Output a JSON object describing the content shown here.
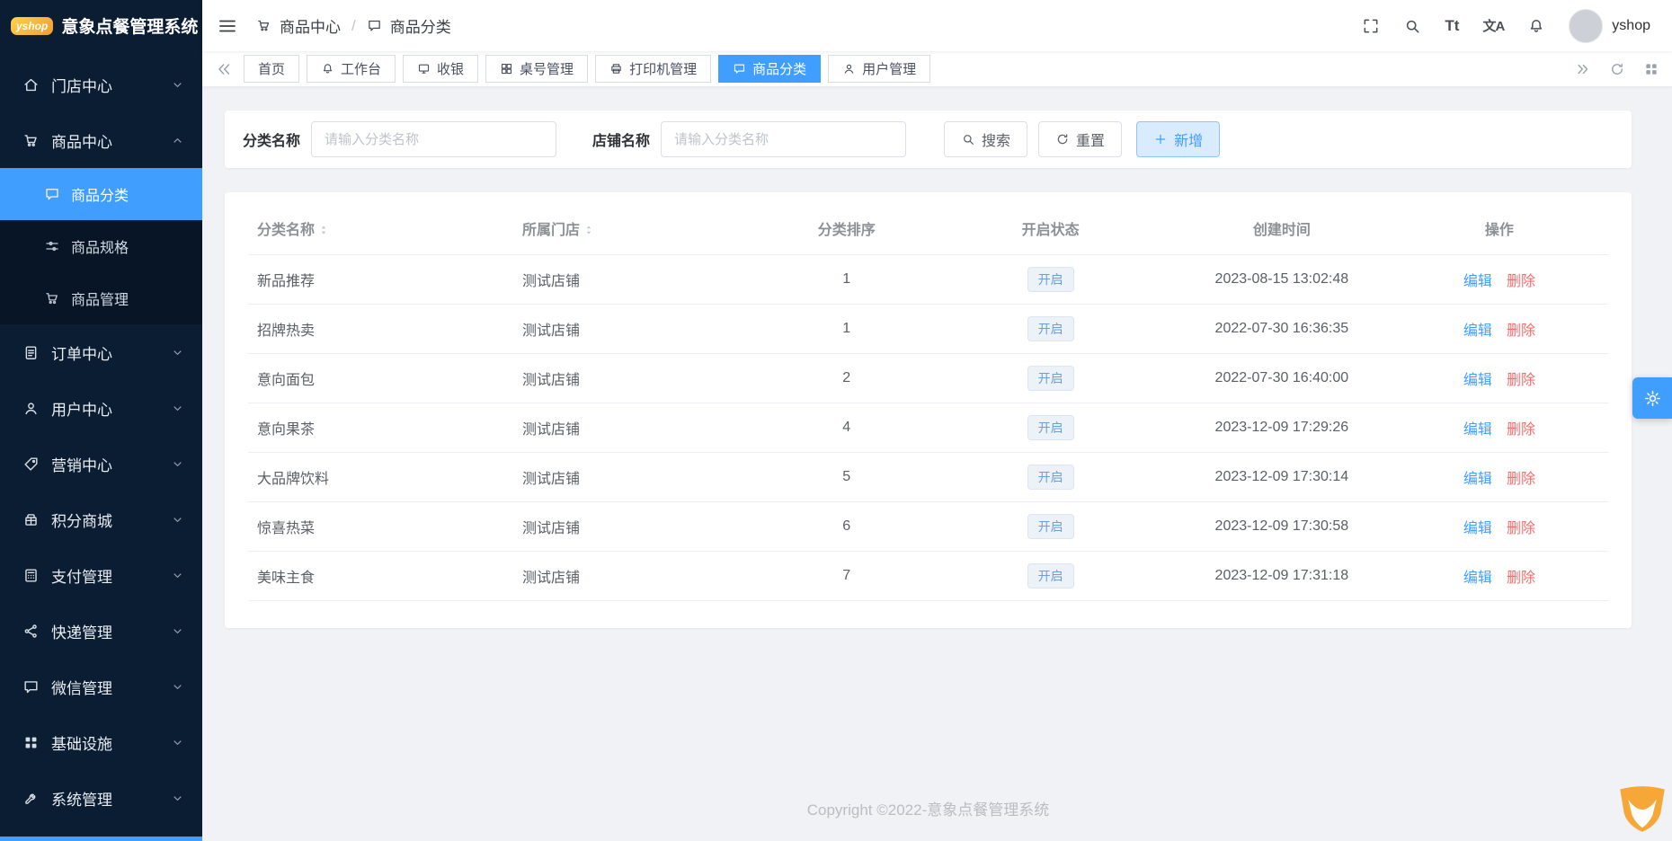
{
  "app": {
    "title": "意象点餐管理系统",
    "logo_text": "yshop",
    "footer": "Copyright ©2022-意象点餐管理系统"
  },
  "header": {
    "breadcrumb": {
      "parent": "商品中心",
      "current": "商品分类"
    },
    "username": "yshop",
    "font_icon": "Tt",
    "translate_icon": "文A"
  },
  "sidebar": {
    "items": [
      {
        "label": "门店中心"
      },
      {
        "label": "商品中心"
      },
      {
        "label": "订单中心"
      },
      {
        "label": "用户中心"
      },
      {
        "label": "营销中心"
      },
      {
        "label": "积分商城"
      },
      {
        "label": "支付管理"
      },
      {
        "label": "快递管理"
      },
      {
        "label": "微信管理"
      },
      {
        "label": "基础设施"
      },
      {
        "label": "系统管理"
      }
    ],
    "submenu": [
      {
        "label": "商品分类"
      },
      {
        "label": "商品规格"
      },
      {
        "label": "商品管理"
      }
    ]
  },
  "tabs": [
    {
      "label": "首页"
    },
    {
      "label": "工作台"
    },
    {
      "label": "收银"
    },
    {
      "label": "桌号管理"
    },
    {
      "label": "打印机管理"
    },
    {
      "label": "商品分类"
    },
    {
      "label": "用户管理"
    }
  ],
  "filters": {
    "category_label": "分类名称",
    "category_placeholder": "请输入分类名称",
    "shop_label": "店铺名称",
    "shop_placeholder": "请输入分类名称",
    "search": "搜索",
    "reset": "重置",
    "add": "新增"
  },
  "table": {
    "columns": [
      "分类名称",
      "所属门店",
      "分类排序",
      "开启状态",
      "创建时间",
      "操作"
    ],
    "edit": "编辑",
    "delete": "删除",
    "rows": [
      {
        "name": "新品推荐",
        "shop": "测试店铺",
        "sort": "1",
        "status": "开启",
        "created": "2023-08-15 13:02:48"
      },
      {
        "name": "招牌热卖",
        "shop": "测试店铺",
        "sort": "1",
        "status": "开启",
        "created": "2022-07-30 16:36:35"
      },
      {
        "name": "意向面包",
        "shop": "测试店铺",
        "sort": "2",
        "status": "开启",
        "created": "2022-07-30 16:40:00"
      },
      {
        "name": "意向果茶",
        "shop": "测试店铺",
        "sort": "4",
        "status": "开启",
        "created": "2023-12-09 17:29:26"
      },
      {
        "name": "大品牌饮料",
        "shop": "测试店铺",
        "sort": "5",
        "status": "开启",
        "created": "2023-12-09 17:30:14"
      },
      {
        "name": "惊喜热菜",
        "shop": "测试店铺",
        "sort": "6",
        "status": "开启",
        "created": "2023-12-09 17:30:58"
      },
      {
        "name": "美味主食",
        "shop": "测试店铺",
        "sort": "7",
        "status": "开启",
        "created": "2023-12-09 17:31:18"
      }
    ]
  },
  "colors": {
    "primary": "#409eff",
    "danger": "#f56c6c",
    "sidebar_bg": "#0a1d33"
  }
}
